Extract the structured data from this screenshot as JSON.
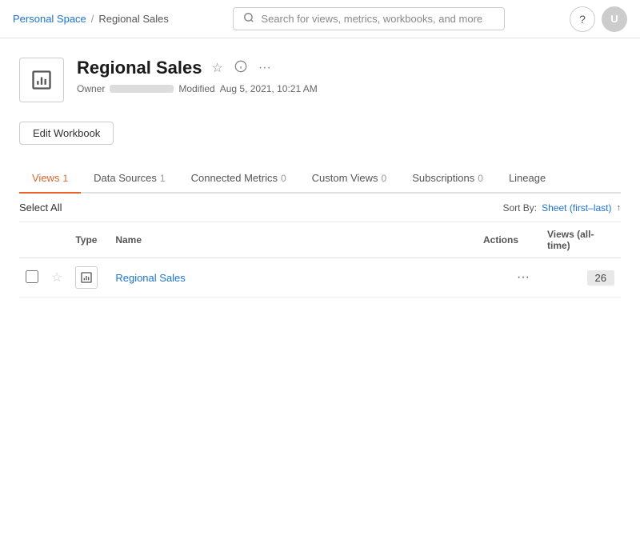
{
  "topnav": {
    "breadcrumb": {
      "personal": "Personal Space",
      "separator": "/",
      "current": "Regional Sales"
    },
    "search": {
      "placeholder": "Search for views, metrics, workbooks, and more"
    }
  },
  "workbook": {
    "title": "Regional Sales",
    "owner_label": "Owner",
    "modified_label": "Modified",
    "modified_date": "Aug 5, 2021, 10:21 AM",
    "edit_button": "Edit Workbook"
  },
  "tabs": [
    {
      "id": "views",
      "label": "Views",
      "count": "1",
      "active": true
    },
    {
      "id": "datasources",
      "label": "Data Sources",
      "count": "1",
      "active": false
    },
    {
      "id": "metrics",
      "label": "Connected Metrics",
      "count": "0",
      "active": false
    },
    {
      "id": "customviews",
      "label": "Custom Views",
      "count": "0",
      "active": false
    },
    {
      "id": "subscriptions",
      "label": "Subscriptions",
      "count": "0",
      "active": false
    },
    {
      "id": "lineage",
      "label": "Lineage",
      "count": "",
      "active": false
    }
  ],
  "toolbar": {
    "select_all": "Select All",
    "sort_by_label": "Sort By:",
    "sort_value": "Sheet (first–last)",
    "sort_arrow": "↑"
  },
  "table": {
    "columns": [
      {
        "id": "type",
        "label": "Type"
      },
      {
        "id": "name",
        "label": "Name"
      },
      {
        "id": "actions",
        "label": "Actions"
      },
      {
        "id": "views",
        "label": "Views (all-time)"
      }
    ],
    "rows": [
      {
        "name": "Regional Sales",
        "type_icon": "bar-chart",
        "views_count": "26"
      }
    ]
  }
}
